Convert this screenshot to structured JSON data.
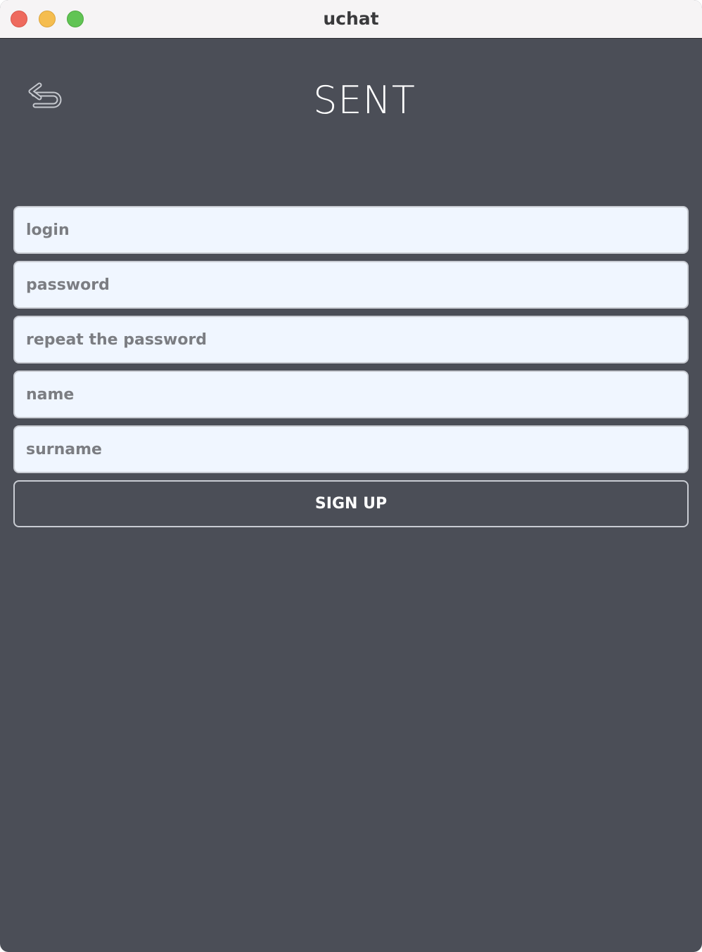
{
  "window": {
    "title": "uchat"
  },
  "header": {
    "back_icon": "undo-arrow-icon",
    "title": "SENT"
  },
  "form": {
    "login_placeholder": "login",
    "password_placeholder": "password",
    "repeat_password_placeholder": "repeat the password",
    "name_placeholder": "name",
    "surname_placeholder": "surname",
    "signup_label": "SIGN UP"
  },
  "colors": {
    "background": "#4b4e57",
    "field_background": "#f0f6ff",
    "border": "#c9ccd3",
    "text": "#ffffff"
  }
}
